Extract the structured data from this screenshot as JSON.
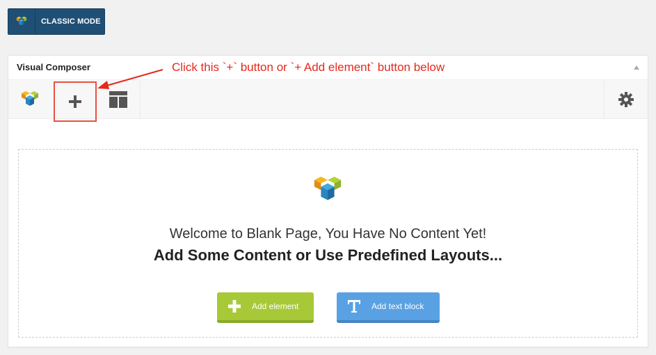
{
  "classic_mode": {
    "label": "CLASSIC MODE"
  },
  "panel": {
    "title": "Visual Composer"
  },
  "annotation": {
    "text": "Click this `+` button or `+ Add element` button below",
    "color": "#e8271b"
  },
  "toolbar": {
    "add_icon": "plus-icon",
    "layout_icon": "layout-icon",
    "settings_icon": "gear-icon"
  },
  "welcome": {
    "line1": "Welcome to Blank Page, You Have No Content Yet!",
    "line2": "Add Some Content or Use Predefined Layouts..."
  },
  "buttons": {
    "add_element": {
      "label": "Add element",
      "color": "#a7c938",
      "icon": "plus-icon"
    },
    "add_text_block": {
      "label": "Add text block",
      "color": "#5aa1e3",
      "icon": "text-t-icon"
    }
  },
  "colors": {
    "brand_dark": "#1f4f75",
    "highlight": "#e85142"
  }
}
